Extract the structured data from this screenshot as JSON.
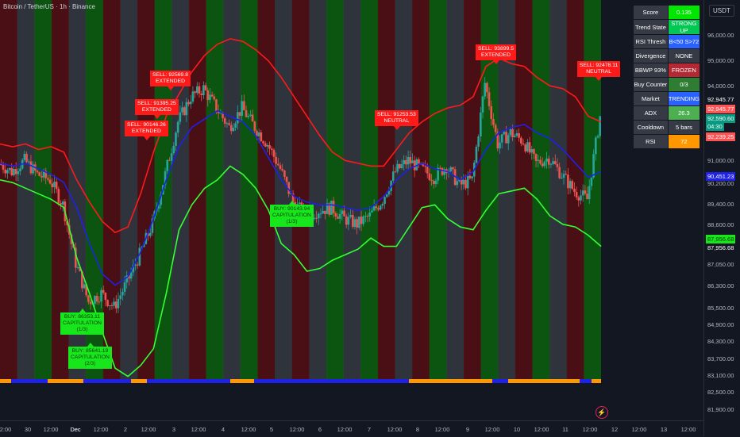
{
  "header": {
    "symbol_title": "Bitcoin / TetherUS · 1h · Binance",
    "currency": "USDT"
  },
  "price_axis": {
    "ticks": [
      "96,000.00",
      "95,000.00",
      "94,000.00",
      "91,000.00",
      "90,200.00",
      "89,400.00",
      "88,600.00",
      "87,050.00",
      "86,300.00",
      "85,500.00",
      "84,900.00",
      "84,300.00",
      "83,700.00",
      "83,100.00",
      "82,500.00",
      "81,900.00"
    ],
    "tags": [
      {
        "text": "92,945.77",
        "bg": "#131722",
        "color": "#ffffff"
      },
      {
        "text": "92,945.77",
        "bg": "#ff5252",
        "color": "#ffffff"
      },
      {
        "text": "92,590.60",
        "bg": "#089981",
        "color": "#ffffff"
      },
      {
        "text": "04:30",
        "bg": "#089981",
        "color": "#ffffff"
      },
      {
        "text": "92,239.25",
        "bg": "#ff5252",
        "color": "#ffffff"
      },
      {
        "text": "90,451.23",
        "bg": "#1e22e6",
        "color": "#ffffff"
      },
      {
        "text": "87,956.68",
        "bg": "#18e61c",
        "color": "#0a3a0a"
      },
      {
        "text": "87,956.68",
        "bg": "#131722",
        "color": "#ffffff"
      }
    ]
  },
  "time_axis": {
    "ticks": [
      "2:00",
      "30",
      "12:00",
      "Dec",
      "12:00",
      "2",
      "12:00",
      "3",
      "12:00",
      "4",
      "12:00",
      "5",
      "12:00",
      "6",
      "12:00",
      "7",
      "12:00",
      "8",
      "12:00",
      "9",
      "12:00",
      "10",
      "12:00",
      "11",
      "12:00",
      "12",
      "12:00",
      "13",
      "12:00"
    ]
  },
  "info_table": {
    "rows": [
      {
        "key": "Score",
        "value": "0.135",
        "bg": "#00e600",
        "color": "#ffffff"
      },
      {
        "key": "Trend State",
        "value": "STRONG UP",
        "bg": "#00c853",
        "color": "#ffffff"
      },
      {
        "key": "RSI Thresh",
        "value": "B<50 S>72",
        "bg": "#2962ff",
        "color": "#ffffff"
      },
      {
        "key": "Divergence",
        "value": "NONE",
        "bg": "#363a45",
        "color": "#ffffff"
      },
      {
        "key": "BBWP 93%",
        "value": "FROZEN",
        "bg": "#b22833",
        "color": "#ffffff"
      },
      {
        "key": "Buy Counter",
        "value": "0/3",
        "bg": "#2e7d32",
        "color": "#ffffff"
      },
      {
        "key": "Market",
        "value": "TRENDING",
        "bg": "#2962ff",
        "color": "#ffffff"
      },
      {
        "key": "ADX",
        "value": "26.3",
        "bg": "#4caf50",
        "color": "#ffffff"
      },
      {
        "key": "Cooldown",
        "value": "5 bars",
        "bg": "#363a45",
        "color": "#ffffff"
      },
      {
        "key": "RSI",
        "value": "72",
        "bg": "#ff9800",
        "color": "#ffffff"
      }
    ]
  },
  "signals": [
    {
      "type": "sell",
      "text": "SELL: 92569.8\nEXTENDED"
    },
    {
      "type": "sell",
      "text": "SELL: 91395.25\nEXTENDED"
    },
    {
      "type": "sell",
      "text": "SELL: 90146.26\nEXTENDED"
    },
    {
      "type": "sell",
      "text": "SELL: 91253.53\nNEUTRAL"
    },
    {
      "type": "sell",
      "text": "SELL: 93899.5\nEXTENDED"
    },
    {
      "type": "sell",
      "text": "SELL: 92478.11\nNEUTRAL"
    },
    {
      "type": "buy",
      "text": "BUY: 86353.11\nCAPITULATION\n(1/3)"
    },
    {
      "type": "buy",
      "text": "BUY: 85641.19\nCAPITULATION\n(2/3)"
    },
    {
      "type": "buy",
      "text": "BUY: 90143.94\nCAPITULATION\n(1/3)"
    }
  ],
  "colors": {
    "background": "#131722",
    "upper_band": "#ff1a1a",
    "middle_line": "#1e22e6",
    "lower_band": "#33ff33",
    "candle_up": "#26a69a",
    "candle_down": "#ef5350",
    "zone_green": "#0b6b0b",
    "zone_red": "#5c0e10",
    "zone_gray": "#3a3d45",
    "bottom_strip_blue": "#1e22e6",
    "bottom_strip_orange": "#ff9800"
  },
  "chart_data": {
    "type": "line",
    "series": [
      {
        "name": "",
        "role": "upper-band",
        "values": [
          91600,
          91500,
          91600,
          91400,
          91500,
          91300,
          90300,
          89500,
          88800,
          88400,
          88600,
          89800,
          91300,
          92600,
          93400,
          94200,
          94800,
          95200,
          95400,
          95300,
          95000,
          94600,
          94000,
          93300,
          92600,
          91900,
          91300,
          91000,
          90900,
          90800,
          90800,
          91400,
          92000,
          92400,
          92700,
          92900,
          93000,
          93300,
          94400,
          94700,
          94500,
          94400,
          94000,
          93700,
          93600,
          93300,
          92600,
          92400
        ]
      },
      {
        "name": "",
        "role": "middle",
        "values": [
          90900,
          90800,
          90900,
          90700,
          90500,
          90200,
          89300,
          88000,
          86900,
          86500,
          86800,
          87700,
          88900,
          90300,
          91500,
          92200,
          92500,
          92800,
          92600,
          92400,
          91900,
          91100,
          90300,
          89700,
          89500,
          89400,
          89400,
          89300,
          89200,
          89300,
          89700,
          90300,
          90700,
          90900,
          90700,
          90600,
          90300,
          90600,
          91400,
          92000,
          92200,
          92300,
          92000,
          91800,
          91400,
          90900,
          90400,
          90600
        ]
      },
      {
        "name": "",
        "role": "lower-band",
        "values": [
          90300,
          90200,
          90000,
          89800,
          89600,
          89300,
          87500,
          86200,
          84800,
          83500,
          83200,
          83600,
          84200,
          86200,
          88500,
          89400,
          90000,
          90300,
          90800,
          90500,
          90000,
          89200,
          88000,
          87600,
          87000,
          87100,
          87400,
          87600,
          87800,
          88200,
          87900,
          87900,
          88600,
          89300,
          89400,
          88900,
          88600,
          88500,
          89200,
          89800,
          89900,
          90000,
          89600,
          89000,
          88700,
          88600,
          88300,
          87900
        ]
      },
      {
        "name": "",
        "role": "close",
        "values": [
          90900,
          90600,
          91000,
          90500,
          90300,
          89400,
          87300,
          85900,
          86200,
          85700,
          86600,
          87600,
          88700,
          90500,
          92400,
          93300,
          93600,
          92900,
          92200,
          92900,
          92200,
          91600,
          90700,
          89500,
          89000,
          89200,
          89300,
          88900,
          88700,
          89000,
          89600,
          90600,
          91000,
          90700,
          90400,
          90800,
          90100,
          90300,
          93800,
          91600,
          92000,
          91700,
          90900,
          91100,
          90500,
          89900,
          89600,
          92600
        ]
      }
    ],
    "xlabel": "",
    "ylabel": "",
    "ylim": [
      81900,
      96800
    ],
    "x_tick_labels": [
      "2:00",
      "30",
      "12:00",
      "Dec",
      "12:00",
      "2",
      "12:00",
      "3",
      "12:00",
      "4",
      "12:00",
      "5",
      "12:00",
      "6",
      "12:00",
      "7",
      "12:00",
      "8",
      "12:00",
      "9",
      "12:00",
      "10",
      "12:00",
      "11",
      "12:00",
      "12",
      "12:00",
      "13",
      "12:00"
    ],
    "y_tick_labels": [
      "96,000.00",
      "95,000.00",
      "94,000.00",
      "91,000.00",
      "90,200.00",
      "89,400.00",
      "88,600.00",
      "87,050.00",
      "86,300.00",
      "85,500.00",
      "84,900.00",
      "84,300.00",
      "83,700.00",
      "83,100.00",
      "82,500.00",
      "81,900.00"
    ],
    "grid": false,
    "background_zones": [
      "red",
      "gray",
      "green",
      "red",
      "gray",
      "green",
      "red",
      "gray",
      "red",
      "green",
      "gray",
      "red",
      "green",
      "gray",
      "green",
      "red",
      "gray",
      "red",
      "gray",
      "green",
      "gray",
      "green",
      "red",
      "gray",
      "red",
      "green",
      "gray",
      "red",
      "green",
      "gray",
      "red",
      "green",
      "gray",
      "red",
      "green"
    ]
  }
}
